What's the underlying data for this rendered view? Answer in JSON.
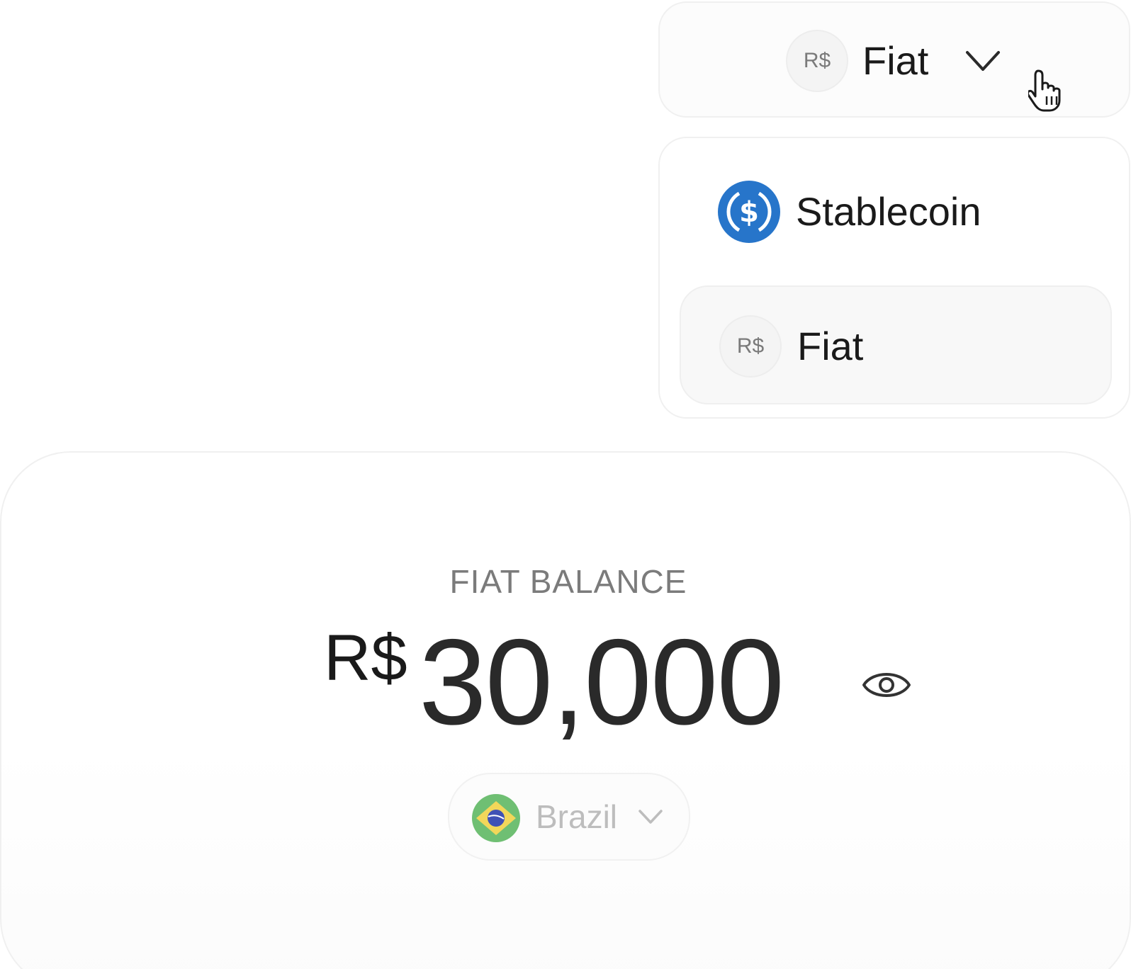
{
  "selector": {
    "badge_text": "R$",
    "label": "Fiat"
  },
  "menu": {
    "items": [
      {
        "label": "Stablecoin",
        "icon": "usdc-coin-icon",
        "icon_color": "#2775ca"
      },
      {
        "label": "Fiat",
        "badge_text": "R$",
        "selected": true
      }
    ]
  },
  "balance": {
    "title": "FIAT BALANCE",
    "currency": "R$",
    "amount": "30,000"
  },
  "country": {
    "label": "Brazil",
    "flag": "brazil-flag-icon"
  },
  "colors": {
    "text_dark": "#1a1a1a",
    "muted": "#7b7b7b",
    "usdc_blue": "#2775ca",
    "flag_green": "#6fbf73",
    "flag_yellow": "#f2d75a",
    "flag_blue": "#3f51b5"
  }
}
